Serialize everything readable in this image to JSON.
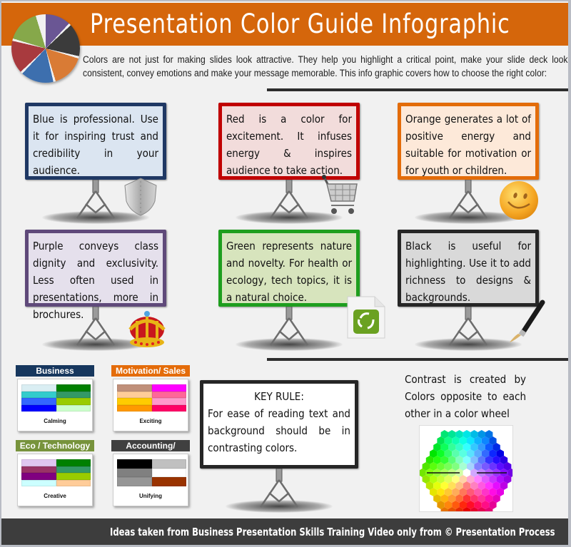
{
  "header": {
    "title": "Presentation Color Guide Infographic",
    "intro": "Colors are not just for making slides look attractive. They help you highlight a critical point, make your slide deck look consistent, convey emotions and make your message memorable. This info graphic covers how to choose the right color:",
    "logo_pie_colors": [
      "#6a5694",
      "#3b3b3b",
      "#d97b35",
      "#3d6fae",
      "#a83a3e",
      "#86a84a"
    ]
  },
  "boards": [
    {
      "id": "blue",
      "text": "Blue is professional. Use it for inspiring trust and credibility in your audience.",
      "border": "#1f3864",
      "fill": "#dbe5f1",
      "icon": "shield-icon"
    },
    {
      "id": "red",
      "text": "Red is a color for excitement. It infuses energy & inspires audience to take action.",
      "border": "#c00000",
      "fill": "#f2dcdb",
      "icon": "shopping-cart-icon"
    },
    {
      "id": "orange",
      "text": "Orange generates a lot of positive energy and suitable for motivation or for youth or children.",
      "border": "#e36c09",
      "fill": "#fde9d9",
      "icon": "smiley-icon"
    },
    {
      "id": "purple",
      "text": "Purple conveys class dignity and exclusivity. Less often used in presentations, more in brochures.",
      "border": "#5f497a",
      "fill": "#e5e0ec",
      "icon": "crown-icon"
    },
    {
      "id": "green",
      "text": "Green represents nature and novelty. For health or ecology, tech topics, it is a natural choice.",
      "border": "#1e9e1e",
      "fill": "#d7e4bd",
      "icon": "recycle-file-icon"
    },
    {
      "id": "black",
      "text": "Black is useful for highlighting. Use it to add richness to designs & backgrounds.",
      "border": "#262626",
      "fill": "#d9d9d9",
      "icon": "paintbrush-icon"
    }
  ],
  "palettes": [
    {
      "title": "Business",
      "head_color": "#17375e",
      "label": "Calming",
      "colors": [
        "#daeef3",
        "#008000",
        "#33cccc",
        "#339966",
        "#3366ff",
        "#99cc00",
        "#0000ff",
        "#ccffcc"
      ]
    },
    {
      "title": "Motivation/ Sales",
      "head_color": "#e46c0a",
      "label": "Exciting",
      "colors": [
        "#c0907a",
        "#ff00ff",
        "#ffcc99",
        "#ff6699",
        "#ffcc00",
        "#ff99cc",
        "#ff9900",
        "#ff0066"
      ]
    },
    {
      "title": "Eco / Technology",
      "head_color": "#77933c",
      "label": "Creative",
      "colors": [
        "#e0c6f0",
        "#008000",
        "#993366",
        "#339966",
        "#800080",
        "#99cc00",
        "#ccffff",
        "#ffcc99"
      ]
    },
    {
      "title": "Accounting/",
      "head_color": "#404040",
      "label": "Unifying",
      "colors": [
        "#000000",
        "#c0c0c0",
        "#808080",
        "#ffffff",
        "#969696",
        "#993300"
      ]
    }
  ],
  "key_rule": {
    "heading": "KEY RULE:",
    "text": "For ease of reading text and background should be in contrasting colors."
  },
  "contrast": {
    "text": "Contrast is created by Colors opposite to each other in a color wheel"
  },
  "footer": {
    "text": "Ideas taken from Business Presentation Skills Training Video only from © Presentation Process"
  }
}
